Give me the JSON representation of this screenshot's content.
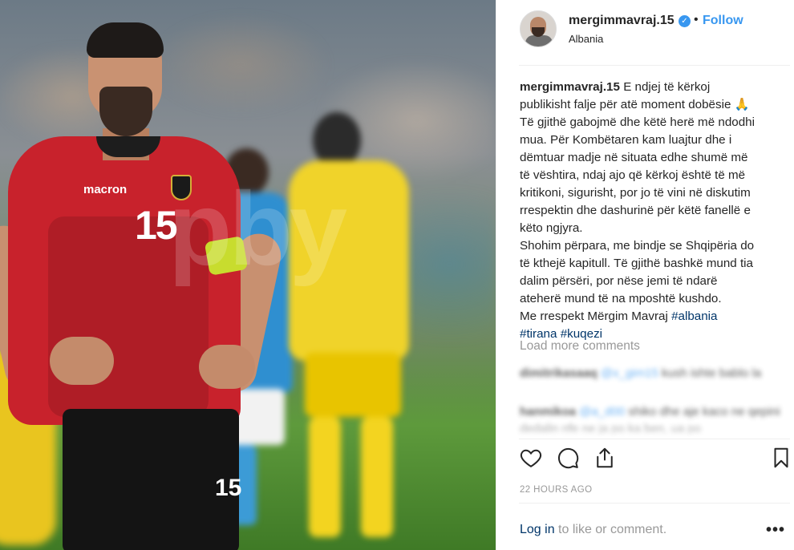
{
  "post": {
    "username": "mergimmavraj.15",
    "verified_icon": "verified-badge-icon",
    "separator": "•",
    "follow_label": "Follow",
    "location": "Albania",
    "caption_username": "mergimmavraj.15",
    "caption_lines": [
      "E ndjej të kërkoj",
      "publikisht falje për atë moment dobësie 🙏",
      "Të gjithë gabojmë dhe këtë herë më ndodhi",
      "mua. Për Kombëtaren kam luajtur dhe i",
      "dëmtuar madje në situata edhe shumë më",
      "të vështira, ndaj ajo që kërkoj është të më",
      "kritikoni, sigurisht, por jo të vini në diskutim",
      "rrespektin dhe dashurinë për këtë fanellë e",
      "këto ngjyra.",
      "Shohim përpara, me bindje se Shqipëria do",
      "të kthejë kapitull. Të gjithë bashkë mund tia",
      "dalim përsëri, por nëse jemi të ndarë",
      "ateherë mund të na mposhtë kushdo.",
      "Me rrespekt Mërgim Mavraj"
    ],
    "hashtags": [
      "#albania",
      "#tirana",
      "#kuqezi"
    ],
    "load_more": "Load more comments",
    "blurred_comments": [
      {
        "user": "dimitrikasaaq",
        "mention": "@x_gim15",
        "text": "kush ishte bablo la"
      },
      {
        "user": "hanmikoa",
        "mention": "@a_d00",
        "text": "shiko dhe aje kaco ne qepini dedalin nfe ne ja po ka ben, ua po"
      }
    ],
    "actions": [
      "heart-icon",
      "comment-icon",
      "share-icon",
      "bookmark-icon"
    ],
    "timestamp": "22 HOURS AGO",
    "login_link": "Log in",
    "login_rest": " to like or comment.",
    "more_label": "•••"
  },
  "photo": {
    "jersey_number": "15",
    "shorts_number": "15",
    "sponsor": "macron",
    "watermark": "pby"
  },
  "colors": {
    "accent_blue": "#3897f0",
    "hashtag": "#003569",
    "muted": "#999999",
    "jersey_red": "#c8222c"
  }
}
